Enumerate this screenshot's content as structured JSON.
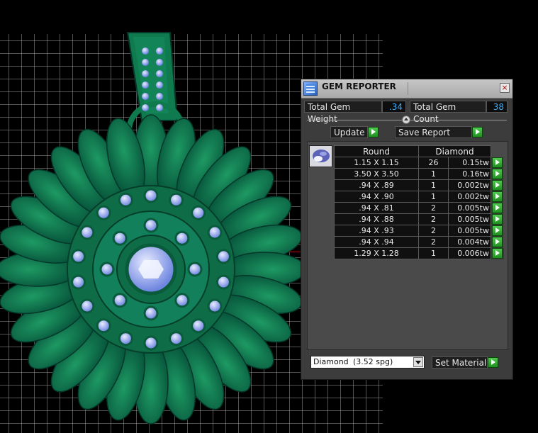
{
  "panel": {
    "title": "GEM REPORTER",
    "close_label": "×",
    "total_gem_weight_label": "Total Gem Weight",
    "total_gem_weight_value": ".34",
    "total_gem_count_label": "Total Gem Count",
    "total_gem_count_value": "38",
    "update_label": "Update",
    "save_report_label": "Save Report",
    "table": {
      "headers": [
        "Round",
        "Diamond"
      ],
      "rows": [
        {
          "size": "1.15 X 1.15",
          "qty": "26",
          "weight": "0.15tw"
        },
        {
          "size": "3.50 X 3.50",
          "qty": "1",
          "weight": "0.16tw"
        },
        {
          "size": ".94 X .89",
          "qty": "1",
          "weight": "0.002tw"
        },
        {
          "size": ".94 X .90",
          "qty": "1",
          "weight": "0.002tw"
        },
        {
          "size": ".94 X .81",
          "qty": "2",
          "weight": "0.005tw"
        },
        {
          "size": ".94 X .88",
          "qty": "2",
          "weight": "0.005tw"
        },
        {
          "size": ".94 X .93",
          "qty": "2",
          "weight": "0.005tw"
        },
        {
          "size": ".94 X .94",
          "qty": "2",
          "weight": "0.004tw"
        },
        {
          "size": "1.29 X 1.28",
          "qty": "1",
          "weight": "0.006tw"
        }
      ]
    },
    "material_name": "Diamond",
    "material_sg": "(3.52 spg)",
    "set_material_label": "Set Material"
  },
  "icons": {
    "app": "gem-reporter-icon",
    "close": "close-icon",
    "play": "play-arrow-icon",
    "gem_thumb": "gem-thumbnail-icon",
    "dropdown": "chevron-down-icon"
  },
  "colors": {
    "pendant_green": "#0f7a4e",
    "stone_blue": "#8fa3f0",
    "value_blue": "#39b0ff",
    "button_green": "#2fae2f"
  }
}
